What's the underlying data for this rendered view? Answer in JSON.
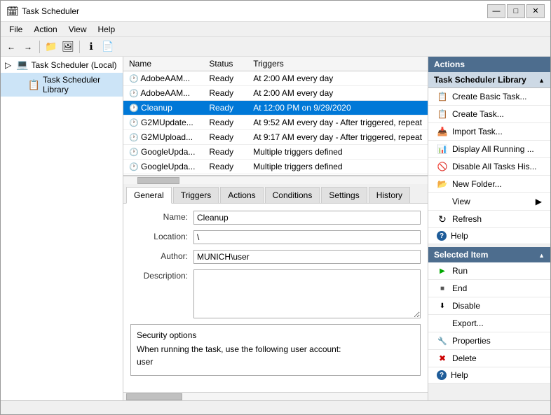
{
  "window": {
    "title": "Task Scheduler",
    "controls": {
      "minimize": "—",
      "maximize": "□",
      "close": "✕"
    }
  },
  "menubar": {
    "items": [
      "File",
      "Action",
      "View",
      "Help"
    ]
  },
  "toolbar": {
    "buttons": [
      "←",
      "→",
      "📁",
      "🖼",
      "ℹ",
      "📄"
    ]
  },
  "tree": {
    "root_label": "Task Scheduler (Local)",
    "child_label": "Task Scheduler Library"
  },
  "task_list": {
    "columns": [
      "Name",
      "Status",
      "Triggers"
    ],
    "rows": [
      {
        "name": "AdobeAAM...",
        "status": "Ready",
        "trigger": "At 2:00 AM every day",
        "selected": false
      },
      {
        "name": "AdobeAAM...",
        "status": "Ready",
        "trigger": "At 2:00 AM every day",
        "selected": false
      },
      {
        "name": "Cleanup",
        "status": "Ready",
        "trigger": "At 12:00 PM on 9/29/2020",
        "selected": true
      },
      {
        "name": "G2MUpdate...",
        "status": "Ready",
        "trigger": "At 9:52 AM every day - After triggered, repeat",
        "selected": false
      },
      {
        "name": "G2MUpload...",
        "status": "Ready",
        "trigger": "At 9:17 AM every day - After triggered, repeat",
        "selected": false
      },
      {
        "name": "GoogleUpda...",
        "status": "Ready",
        "trigger": "Multiple triggers defined",
        "selected": false
      },
      {
        "name": "GoogleUpda...",
        "status": "Ready",
        "trigger": "Multiple triggers defined",
        "selected": false
      }
    ]
  },
  "tabs": [
    "General",
    "Triggers",
    "Actions",
    "Conditions",
    "Settings",
    "History"
  ],
  "active_tab": "General",
  "detail": {
    "name_label": "Name:",
    "name_value": "Cleanup",
    "location_label": "Location:",
    "location_value": "\\",
    "author_label": "Author:",
    "author_value": "MUNICH\\user",
    "description_label": "Description:",
    "description_value": "",
    "security_title": "Security options",
    "security_text": "When running the task, use the following user account:",
    "security_user": "user"
  },
  "actions_panel": {
    "header": "Actions",
    "subheader": "Task Scheduler Library",
    "items": [
      {
        "label": "Create Basic Task...",
        "icon": "create"
      },
      {
        "label": "Create Task...",
        "icon": "create"
      },
      {
        "label": "Import Task...",
        "icon": "import"
      },
      {
        "label": "Display All Running ...",
        "icon": "running"
      },
      {
        "label": "Disable All Tasks His...",
        "icon": "disable-all"
      },
      {
        "label": "New Folder...",
        "icon": "new-folder"
      },
      {
        "label": "View",
        "icon": "view",
        "hasArrow": true
      },
      {
        "label": "Refresh",
        "icon": "refresh"
      },
      {
        "label": "Help",
        "icon": "help"
      }
    ],
    "selected_header": "Selected Item",
    "selected_items": [
      {
        "label": "Run",
        "icon": "run"
      },
      {
        "label": "End",
        "icon": "end"
      },
      {
        "label": "Disable",
        "icon": "disable"
      },
      {
        "label": "Export...",
        "icon": "export"
      },
      {
        "label": "Properties",
        "icon": "properties"
      },
      {
        "label": "Delete",
        "icon": "delete"
      },
      {
        "label": "Help",
        "icon": "help2"
      }
    ]
  },
  "status_bar": ""
}
